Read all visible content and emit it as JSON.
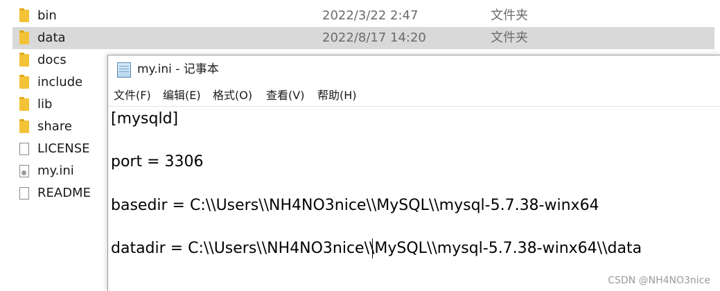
{
  "explorer": {
    "files": [
      {
        "name": "bin",
        "date": "2022/3/22 2:47",
        "type": "文件夹",
        "kind": "folder"
      },
      {
        "name": "data",
        "date": "2022/8/17 14:20",
        "type": "文件夹",
        "kind": "folder",
        "selected": true
      },
      {
        "name": "docs",
        "kind": "folder"
      },
      {
        "name": "include",
        "kind": "folder"
      },
      {
        "name": "lib",
        "kind": "folder"
      },
      {
        "name": "share",
        "kind": "folder"
      },
      {
        "name": "LICENSE",
        "kind": "file"
      },
      {
        "name": "my.ini",
        "kind": "config-file"
      },
      {
        "name": "README",
        "kind": "file"
      }
    ]
  },
  "notepad": {
    "title": "my.ini - 记事本",
    "menu": [
      "文件(F)",
      "编辑(E)",
      "格式(O)",
      "查看(V)",
      "帮助(H)"
    ],
    "lines": [
      "[mysqld]",
      "port = 3306",
      "basedir = C:\\\\Users\\\\NH4NO3nice\\\\MySQL\\\\mysql-5.7.38-winx64",
      "datadir = C:\\\\Users\\\\NH4NO3nice\\\\MySQL\\\\mysql-5.7.38-winx64\\\\data"
    ]
  },
  "watermark": "CSDN @NH4NO3nice",
  "colors": {
    "selection": "#d9d9d9",
    "folder": "#f3c237",
    "secondary_text": "#6b6b6b"
  }
}
